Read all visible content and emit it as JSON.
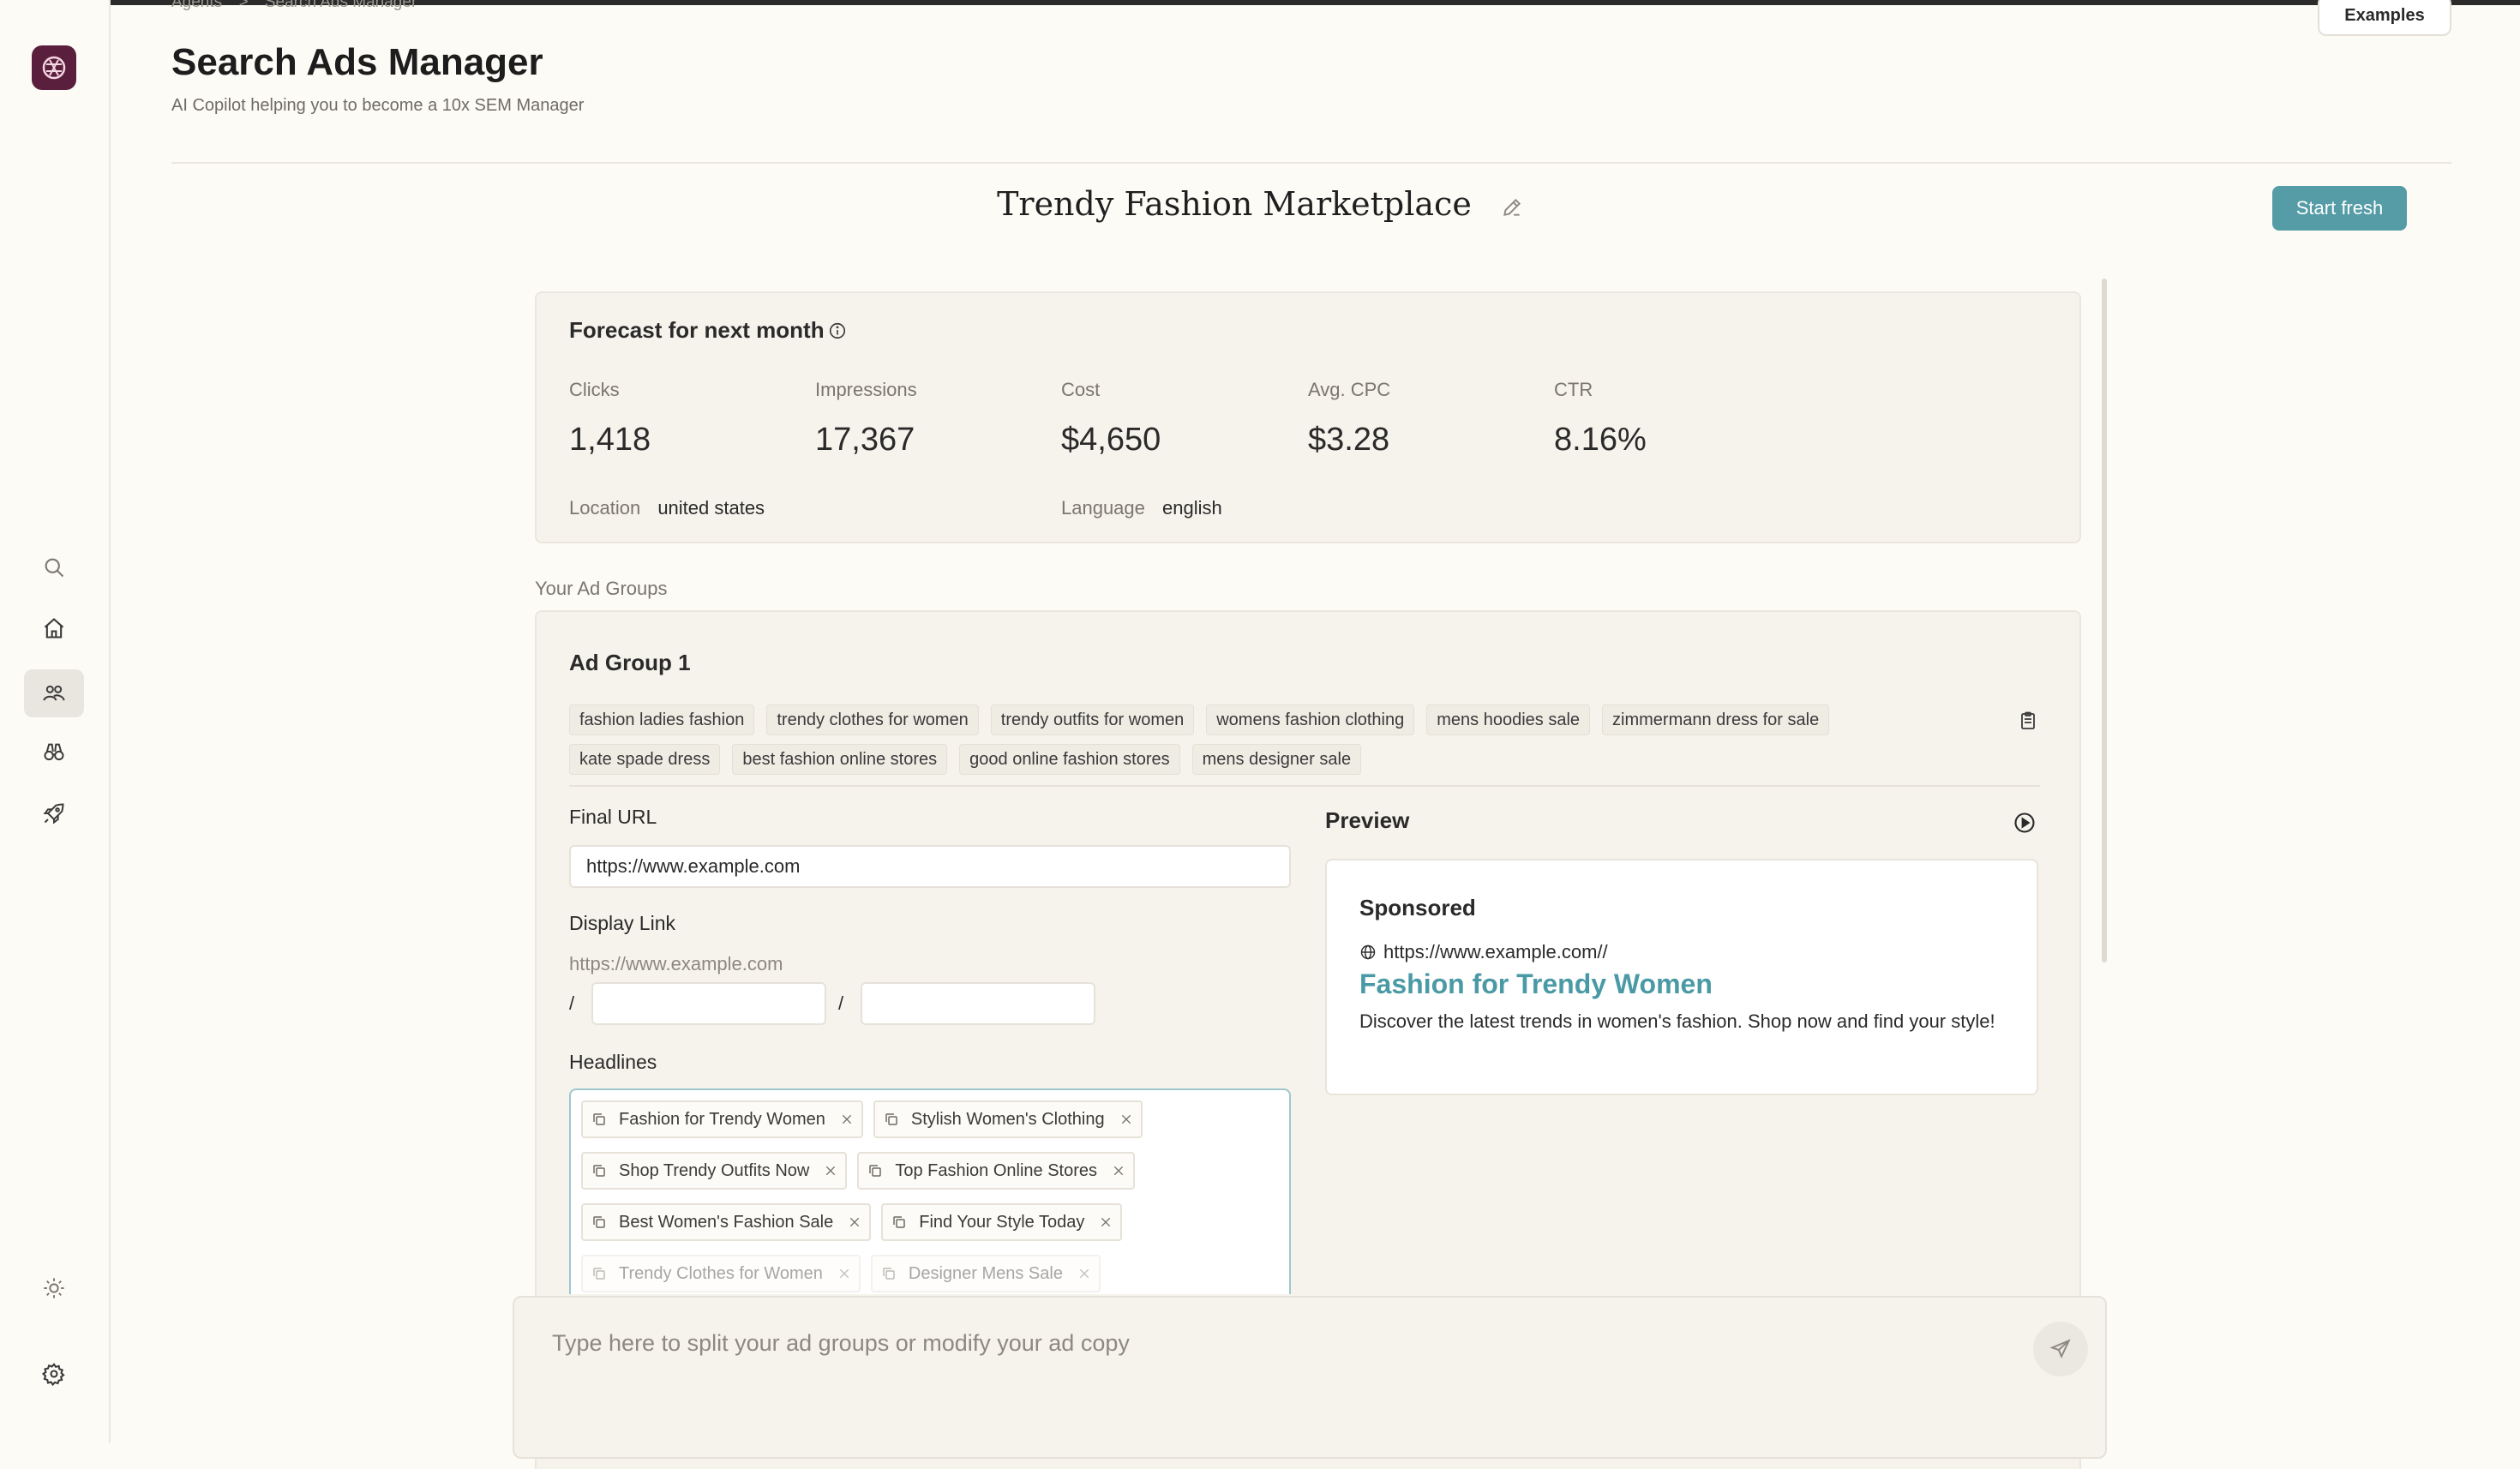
{
  "breadcrumb": {
    "items": [
      "Agents",
      ">",
      "Search Ads Manager"
    ]
  },
  "header": {
    "title": "Search Ads Manager",
    "subtitle": "AI Copilot helping you to become a 10x SEM Manager",
    "examples_label": "Examples"
  },
  "project": {
    "title": "Trendy Fashion Marketplace",
    "start_fresh_label": "Start fresh"
  },
  "forecast": {
    "title": "Forecast for next month",
    "metrics": [
      {
        "label": "Clicks",
        "value": "1,418"
      },
      {
        "label": "Impressions",
        "value": "17,367"
      },
      {
        "label": "Cost",
        "value": "$4,650"
      },
      {
        "label": "Avg. CPC",
        "value": "$3.28"
      },
      {
        "label": "CTR",
        "value": "8.16%"
      }
    ],
    "location_label": "Location",
    "location_value": "united states",
    "language_label": "Language",
    "language_value": "english"
  },
  "ad_groups_label": "Your Ad Groups",
  "ad_group": {
    "title": "Ad Group 1",
    "keywords": [
      "fashion ladies fashion",
      "trendy clothes for women",
      "trendy outfits for women",
      "womens fashion clothing",
      "mens hoodies sale",
      "zimmermann dress for sale",
      "kate spade dress",
      "best fashion online stores",
      "good online fashion stores",
      "mens designer sale"
    ],
    "final_url_label": "Final URL",
    "final_url_value": "https://www.example.com",
    "display_link_label": "Display Link",
    "display_link_base": "https://www.example.com",
    "slash": "/",
    "path1": "",
    "path2": "",
    "headlines_label": "Headlines",
    "headlines": [
      [
        "Fashion for Trendy Women",
        "Stylish Women's Clothing"
      ],
      [
        "Shop Trendy Outfits Now",
        "Top Fashion Online Stores"
      ],
      [
        "Best Women's Fashion Sale",
        "Find Your Style Today"
      ],
      [
        "Trendy Clothes for Women",
        "Designer Mens Sale"
      ]
    ]
  },
  "preview": {
    "label": "Preview",
    "sponsored": "Sponsored",
    "url": "https://www.example.com//",
    "headline": "Fashion for Trendy Women",
    "description": "Discover the latest trends in women's fashion. Shop now and find your style!"
  },
  "chat": {
    "placeholder": "Type here to split your ad groups or modify your ad copy"
  },
  "sidebar": {
    "icons": [
      "search-icon",
      "home-icon",
      "agents-icon",
      "binoculars-icon",
      "rocket-icon",
      "sun-icon",
      "settings-icon"
    ]
  },
  "colors": {
    "accent": "#559ca6",
    "logo_bg": "#5a1f3c",
    "background": "#fdfbf6"
  }
}
